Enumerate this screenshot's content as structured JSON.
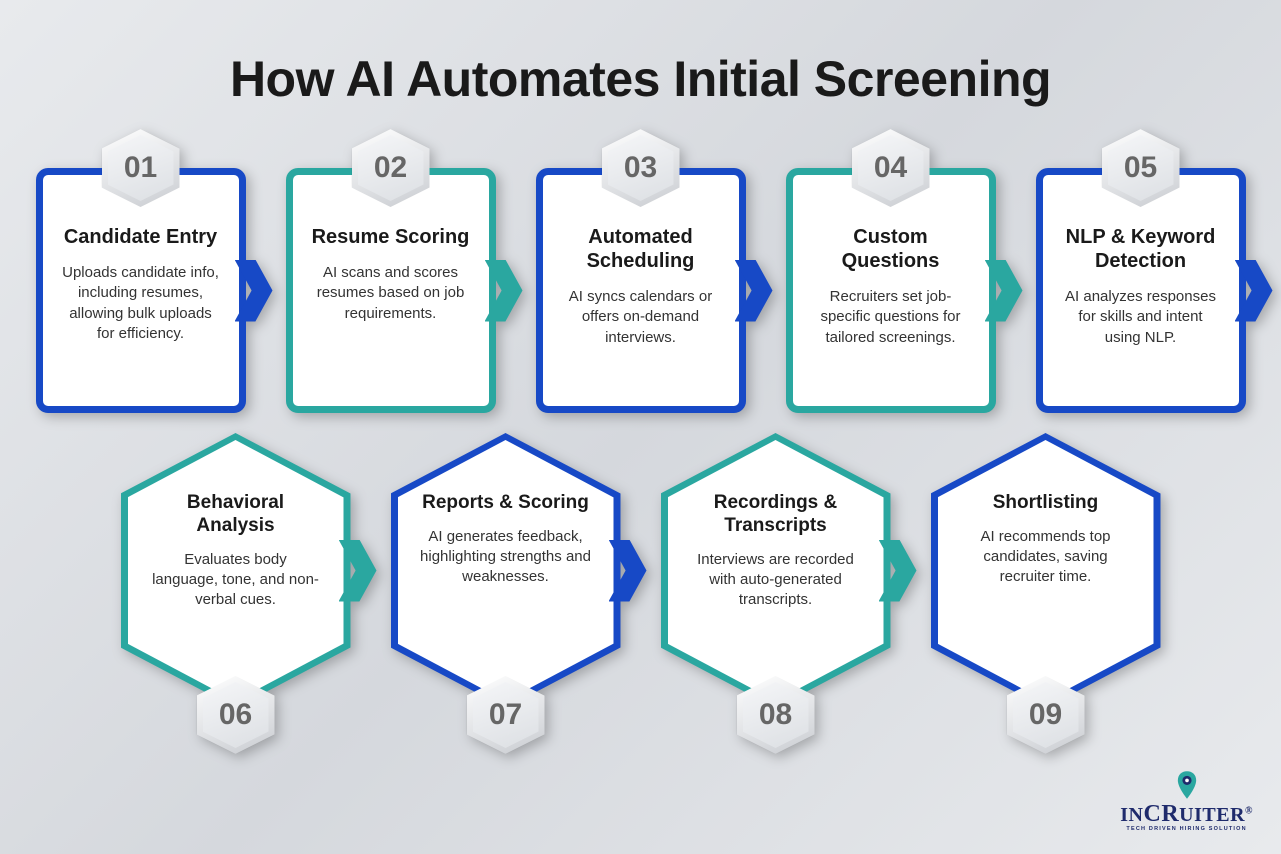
{
  "title": "How AI Automates Initial Screening",
  "steps_top": [
    {
      "num": "01",
      "heading": "Candidate Entry",
      "body": "Uploads candidate info, including resumes, allowing bulk uploads for efficiency.",
      "color": "blue"
    },
    {
      "num": "02",
      "heading": "Resume Scoring",
      "body": "AI scans and scores resumes based on job requirements.",
      "color": "teal"
    },
    {
      "num": "03",
      "heading": "Automated Scheduling",
      "body": "AI syncs calendars or offers on-demand interviews.",
      "color": "blue"
    },
    {
      "num": "04",
      "heading": "Custom Questions",
      "body": "Recruiters set job-specific questions for tailored screenings.",
      "color": "teal"
    },
    {
      "num": "05",
      "heading": "NLP & Keyword Detection",
      "body": "AI analyzes responses for skills and intent using NLP.",
      "color": "blue"
    }
  ],
  "steps_bottom": [
    {
      "num": "06",
      "heading": "Behavioral Analysis",
      "body": "Evaluates body language, tone, and non-verbal cues.",
      "color": "teal"
    },
    {
      "num": "07",
      "heading": "Reports & Scoring",
      "body": "AI generates feedback, highlighting strengths and weaknesses.",
      "color": "blue"
    },
    {
      "num": "08",
      "heading": "Recordings & Transcripts",
      "body": "Interviews are recorded with auto-generated transcripts.",
      "color": "teal"
    },
    {
      "num": "09",
      "heading": "Shortlisting",
      "body": "AI recommends top candidates, saving recruiter time.",
      "color": "blue"
    }
  ],
  "brand": {
    "name_pre": "I",
    "name_n": "N",
    "name_c": "C",
    "name_r": "R",
    "name_rest": "UITER",
    "tagline": "TECH DRIVEN HIRING SOLUTION"
  }
}
